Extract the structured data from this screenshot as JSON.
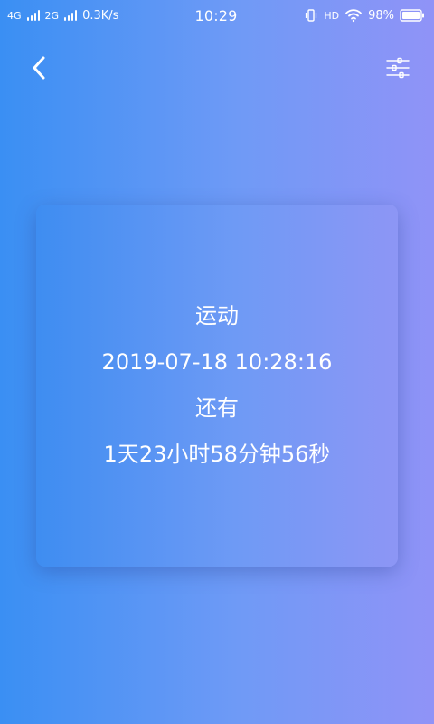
{
  "status_bar": {
    "net_1": "4G",
    "net_2": "2G",
    "speed": "0.3K/s",
    "time": "10:29",
    "hd": "HD",
    "battery": "98%"
  },
  "card": {
    "title": "运动",
    "datetime": "2019-07-18 10:28:16",
    "remaining_label": "还有",
    "countdown": "1天23小时58分钟56秒"
  },
  "colors": {
    "background_start": "#3a8ff3",
    "background_end": "#9093f7",
    "card_start": "#3e8df1",
    "card_end": "#8d96f5",
    "text": "#ffffff"
  },
  "icons": {
    "back": "chevron-left-icon",
    "settings": "sliders-icon",
    "vibrate": "vibrate-icon",
    "wifi": "wifi-icon",
    "battery": "battery-icon"
  }
}
